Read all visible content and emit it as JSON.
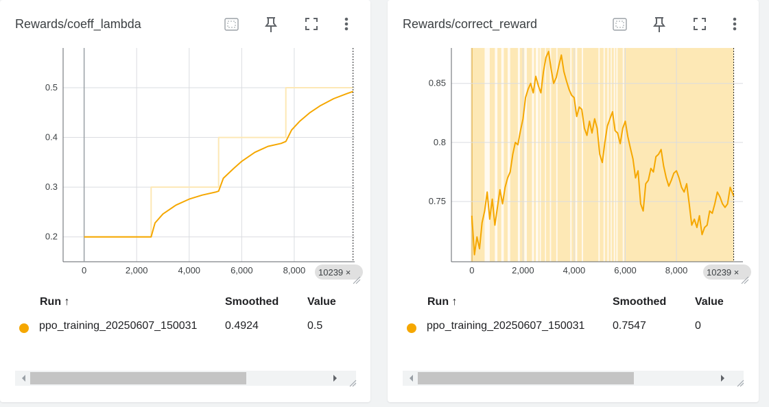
{
  "colors": {
    "line": "#f5a700",
    "raw": "#fde8b5",
    "grid": "#dadce0",
    "axis": "#5f6368",
    "dot": "#f5a700"
  },
  "icons": {
    "fit": "fit-domain-icon",
    "pin": "pin-icon",
    "fullscreen": "fullscreen-icon",
    "menu": "more-vert-icon"
  },
  "cards": [
    {
      "title": "Rewards/coeff_lambda",
      "table": {
        "col_run": "Run ↑",
        "col_smoothed": "Smoothed",
        "col_value": "Value",
        "run": "ppo_training_20250607_150031",
        "smoothed": "0.4924",
        "value": "0.5"
      },
      "chart_data": {
        "type": "line",
        "xlim": [
          -800,
          10300
        ],
        "ylim": [
          0.15,
          0.5799
        ],
        "x_ticks": [
          0,
          2000,
          4000,
          6000,
          8000
        ],
        "x_tick_labels": [
          "0",
          "2,000",
          "4,000",
          "6,000",
          "8,000"
        ],
        "y_ticks": [
          0.2,
          0.3,
          0.4,
          0.5
        ],
        "y_tick_labels": [
          "0.2",
          "0.3",
          "0.4",
          "0.5"
        ],
        "hover_step_label": "10239 ×",
        "hover_step": 10239,
        "series": [
          {
            "role": "raw",
            "x": [
              0,
              2550,
              2550,
              5120,
              5120,
              7680,
              7680,
              10239
            ],
            "y": [
              0.2,
              0.2,
              0.3,
              0.3,
              0.4,
              0.4,
              0.5,
              0.5
            ]
          },
          {
            "role": "smoothed",
            "x": [
              0,
              2550,
              2700,
              3000,
              3500,
              4000,
              4500,
              5000,
              5120,
              5300,
              5700,
              6000,
              6500,
              7000,
              7500,
              7680,
              7900,
              8200,
              8600,
              9000,
              9500,
              10000,
              10239
            ],
            "y": [
              0.2,
              0.2,
              0.228,
              0.246,
              0.264,
              0.276,
              0.284,
              0.29,
              0.292,
              0.318,
              0.338,
              0.352,
              0.37,
              0.382,
              0.388,
              0.392,
              0.415,
              0.432,
              0.45,
              0.464,
              0.478,
              0.488,
              0.4924
            ]
          }
        ]
      }
    },
    {
      "title": "Rewards/correct_reward",
      "table": {
        "col_run": "Run ↑",
        "col_smoothed": "Smoothed",
        "col_value": "Value",
        "run": "ppo_training_20250607_150031",
        "smoothed": "0.7547",
        "value": "0"
      },
      "chart_data": {
        "type": "line",
        "xlim": [
          -800,
          10600
        ],
        "ylim": [
          0.699,
          0.88
        ],
        "x_ticks": [
          0,
          2000,
          4000,
          6000,
          8000
        ],
        "x_tick_labels": [
          "0",
          "2,000",
          "4,000",
          "6,000",
          "8,000"
        ],
        "y_ticks": [
          0.75,
          0.8,
          0.85
        ],
        "y_tick_labels": [
          "0.75",
          "0.8",
          "0.85"
        ],
        "hover_step_label": "10239 ×",
        "hover_step": 10239,
        "raw_band": {
          "x_from": 0,
          "x_to": 10239
        },
        "raw_gaps": [
          [
            500,
            700
          ],
          [
            900,
            1000
          ],
          [
            1150,
            1250
          ],
          [
            1400,
            1500
          ],
          [
            1800,
            1880
          ],
          [
            2050,
            2150
          ],
          [
            2350,
            2430
          ],
          [
            2500,
            2600
          ],
          [
            2650,
            2700
          ],
          [
            2860,
            2900
          ],
          [
            3050,
            3100
          ],
          [
            3300,
            3350
          ],
          [
            3850,
            3900
          ],
          [
            4050,
            4120
          ],
          [
            4300,
            4350
          ],
          [
            4950,
            5000
          ],
          [
            5150,
            5200
          ],
          [
            5300,
            5350
          ],
          [
            5430,
            5470
          ],
          [
            5550,
            5600
          ],
          [
            5650,
            5700
          ],
          [
            5900,
            5950
          ]
        ],
        "series": [
          {
            "role": "smoothed",
            "x": [
              0,
              100,
              200,
              300,
              400,
              500,
              600,
              700,
              800,
              900,
              1000,
              1100,
              1200,
              1300,
              1400,
              1500,
              1600,
              1700,
              1800,
              1900,
              2000,
              2100,
              2200,
              2300,
              2400,
              2500,
              2600,
              2700,
              2800,
              2900,
              3000,
              3100,
              3200,
              3300,
              3400,
              3500,
              3600,
              3700,
              3800,
              3900,
              4000,
              4100,
              4200,
              4300,
              4400,
              4500,
              4600,
              4700,
              4800,
              4900,
              5000,
              5100,
              5200,
              5300,
              5400,
              5500,
              5600,
              5700,
              5800,
              5900,
              6000,
              6100,
              6200,
              6300,
              6400,
              6500,
              6600,
              6700,
              6800,
              6900,
              7000,
              7100,
              7200,
              7300,
              7400,
              7500,
              7600,
              7700,
              7800,
              7900,
              8000,
              8100,
              8200,
              8300,
              8400,
              8500,
              8600,
              8700,
              8800,
              8900,
              9000,
              9100,
              9200,
              9300,
              9400,
              9500,
              9600,
              9700,
              9800,
              9900,
              10000,
              10100,
              10239
            ],
            "y": [
              0.738,
              0.705,
              0.72,
              0.71,
              0.732,
              0.742,
              0.758,
              0.735,
              0.752,
              0.73,
              0.745,
              0.76,
              0.748,
              0.762,
              0.77,
              0.775,
              0.79,
              0.8,
              0.798,
              0.81,
              0.82,
              0.838,
              0.845,
              0.85,
              0.842,
              0.856,
              0.848,
              0.842,
              0.86,
              0.872,
              0.877,
              0.862,
              0.85,
              0.855,
              0.865,
              0.874,
              0.86,
              0.852,
              0.845,
              0.84,
              0.838,
              0.822,
              0.83,
              0.828,
              0.812,
              0.806,
              0.818,
              0.808,
              0.82,
              0.812,
              0.79,
              0.783,
              0.8,
              0.814,
              0.82,
              0.826,
              0.81,
              0.808,
              0.799,
              0.812,
              0.818,
              0.805,
              0.795,
              0.786,
              0.77,
              0.776,
              0.748,
              0.742,
              0.765,
              0.768,
              0.778,
              0.775,
              0.788,
              0.79,
              0.794,
              0.78,
              0.77,
              0.763,
              0.768,
              0.774,
              0.776,
              0.77,
              0.762,
              0.758,
              0.765,
              0.748,
              0.73,
              0.735,
              0.728,
              0.738,
              0.722,
              0.728,
              0.73,
              0.742,
              0.74,
              0.748,
              0.758,
              0.754,
              0.748,
              0.745,
              0.748,
              0.762,
              0.7547
            ]
          }
        ]
      }
    }
  ]
}
